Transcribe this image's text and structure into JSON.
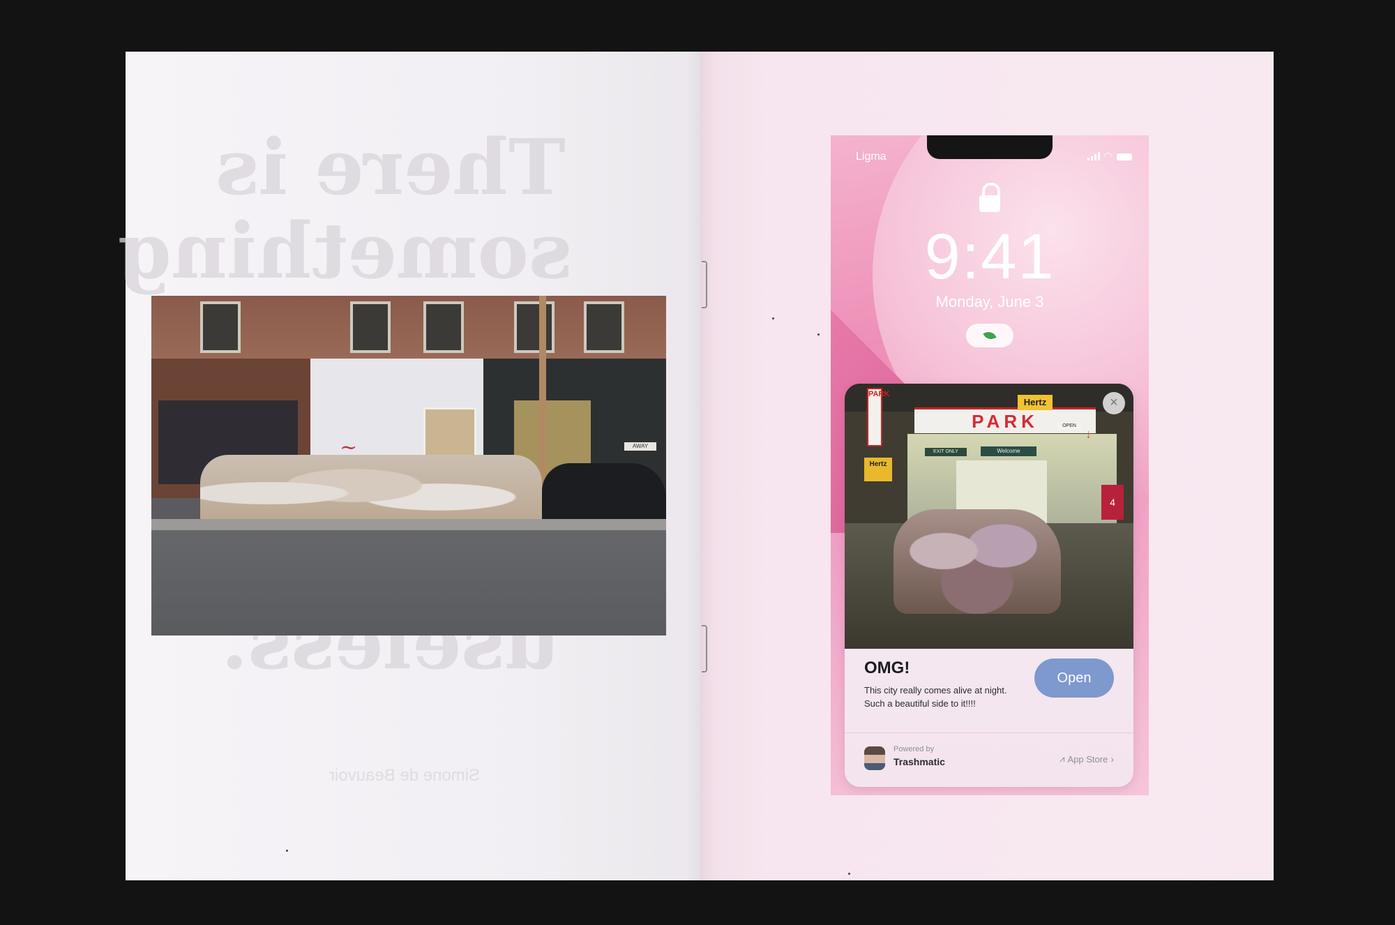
{
  "left_page": {
    "ghost_quote_lines": [
      "There is",
      "something",
      "useless."
    ],
    "ghost_author": "Simone de Beauvoir"
  },
  "right_page": {
    "phone": {
      "carrier": "Ligma",
      "time": "9:41",
      "date": "Monday, June 3",
      "notification": {
        "title": "OMG!",
        "body": "This city really comes alive at night. Such a beautiful side to it!!!!",
        "open_label": "Open",
        "close_symbol": "×",
        "powered_by": "Powered by",
        "app_name": "Trashmatic",
        "store_label": "App Store"
      },
      "photo_signs": {
        "park": "PARK",
        "hertz": "Hertz",
        "hertz_small": "Hertz",
        "vertical": "PARK",
        "exit": "EXIT ONLY",
        "welcome": "Welcome",
        "open": "OPEN"
      }
    }
  },
  "photo_left_signs": {
    "away": "AWAY"
  },
  "icons": [
    "lock-icon",
    "signal-icon",
    "wifi-icon",
    "battery-icon",
    "leaf-icon",
    "close-icon",
    "appstore-icon",
    "chevron-right-icon",
    "avatar"
  ]
}
